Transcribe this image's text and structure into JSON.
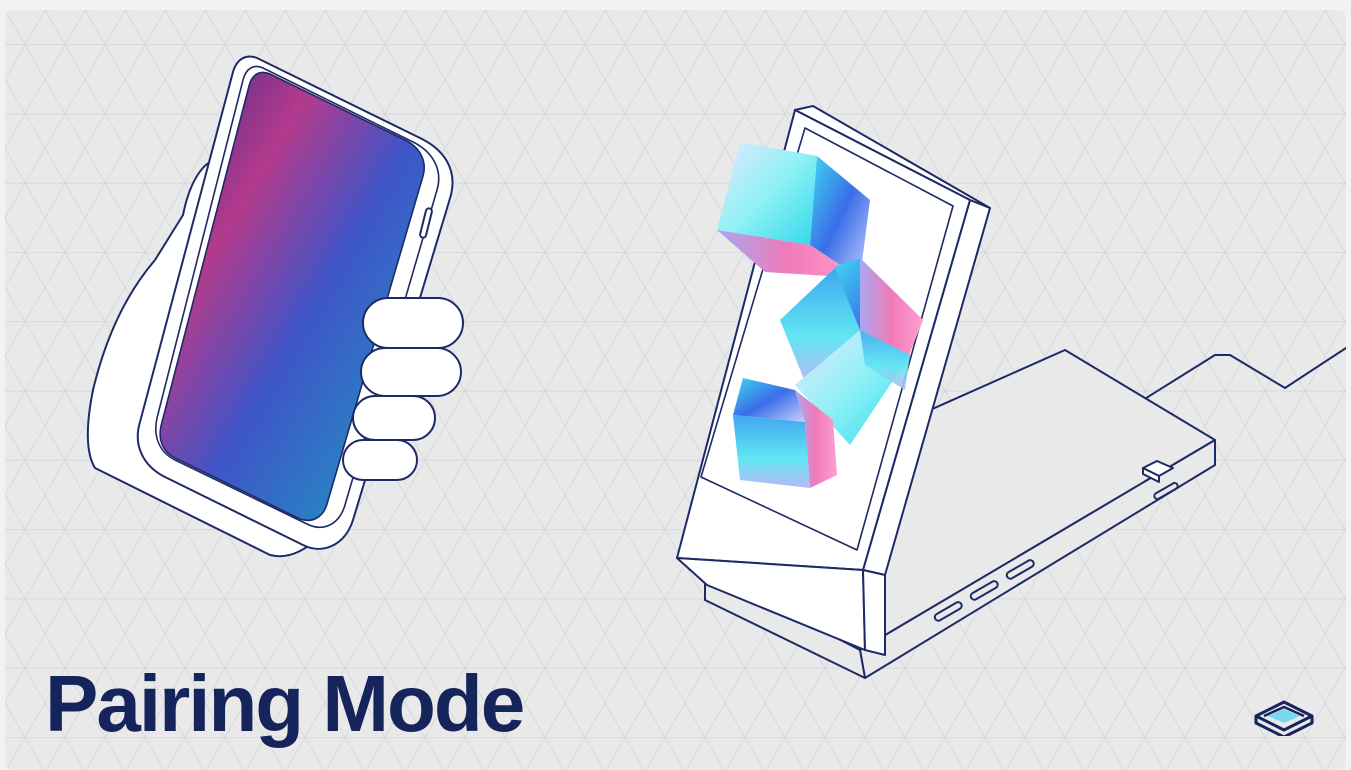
{
  "title": "Pairing Mode",
  "colors": {
    "background": "#e9e9ea",
    "line": "#1d2a66",
    "title": "#16245c",
    "accent_cyan": "#3fe3f0",
    "accent_pink": "#f06bb0",
    "accent_blue": "#3b5fe0"
  },
  "icons": [
    "hand-holding-phone",
    "display-dock-with-cubes",
    "brand-logo-icon"
  ]
}
